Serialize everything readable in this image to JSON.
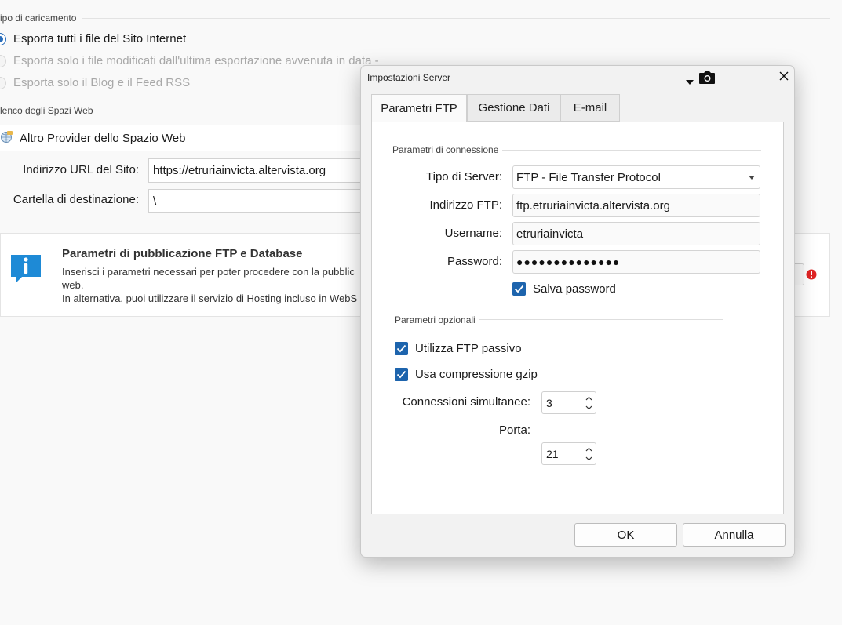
{
  "background": {
    "upload_section_title": "ipo di caricamento",
    "upload_options": [
      {
        "label": "Esporta tutti i file del Sito Internet",
        "selected": true,
        "enabled": true
      },
      {
        "label": "Esporta solo i file modificati dall'ultima esportazione avvenuta in data -",
        "selected": false,
        "enabled": false
      },
      {
        "label": "Esporta solo il Blog e il Feed RSS",
        "selected": false,
        "enabled": false
      }
    ],
    "webspace_section_title": "lenco degli Spazi Web",
    "provider_label": "Altro Provider dello Spazio Web",
    "url_label": "Indirizzo URL del Sito:",
    "url_value": "https://etruriainvicta.altervista.org",
    "dest_label": "Cartella di destinazione:",
    "dest_value": "\\",
    "info": {
      "title": "Parametri di pubblicazione FTP e Database",
      "line1": "Inserisci i parametri necessari per poter procedere con la pubblic",
      "line2": "web.",
      "line3": "In alternativa, puoi utilizzare il servizio di Hosting incluso in WebS"
    }
  },
  "dialog": {
    "title": "Impostazioni Server",
    "tabs": [
      "Parametri FTP",
      "Gestione Dati",
      "E-mail"
    ],
    "active_tab": 0,
    "connection_group": "Parametri di connessione",
    "server_type_label": "Tipo di Server:",
    "server_type_value": "FTP - File Transfer Protocol",
    "ftp_address_label": "Indirizzo FTP:",
    "ftp_address_value": "ftp.etruriainvicta.altervista.org",
    "username_label": "Username:",
    "username_value": "etruriainvicta",
    "password_label": "Password:",
    "password_mask": "●●●●●●●●●●●●●●",
    "save_password_label": "Salva password",
    "optional_group": "Parametri opzionali",
    "passive_ftp_label": "Utilizza FTP passivo",
    "gzip_label": "Usa compressione gzip",
    "connections_label": "Connessioni simultanee:",
    "connections_value": "3",
    "port_label": "Porta:",
    "port_value": "21",
    "ok_label": "OK",
    "cancel_label": "Annulla"
  },
  "colors": {
    "accent": "#1d64ad",
    "info_icon": "#1e8ad6",
    "error_badge": "#e02424"
  }
}
